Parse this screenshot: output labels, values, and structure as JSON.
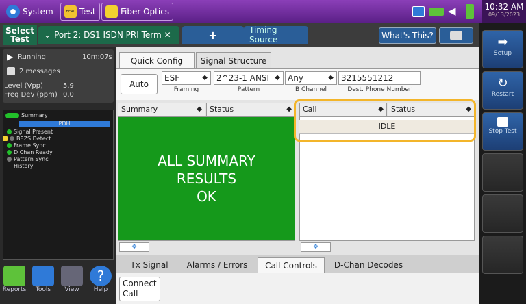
{
  "topbar": {
    "system_label": "System",
    "test_label": "Test",
    "bert_badge": "BERT",
    "fiber_label": "Fiber Optics",
    "clock_time": "10:32 AM",
    "clock_date": "09/13/2023"
  },
  "tabs": {
    "select_test": "Select Test",
    "port_tab": "Port 2: DS1 ISDN PRI Term",
    "plus_tab": "+",
    "timing_tab": "Timing Source",
    "whats_this": "What's This?"
  },
  "status": {
    "running_label": "Running",
    "running_time": "10m:07s",
    "messages": "2 messages",
    "level_label": "Level (Vpp)",
    "level_value": "5.9",
    "freq_label": "Freq Dev (ppm)",
    "freq_value": "0.0"
  },
  "tree": {
    "summary": "Summary",
    "pdh": "PDH",
    "signal_present": "Signal Present",
    "b8zs_detect": "B8ZS Detect",
    "frame_sync": "Frame Sync",
    "d_chan_ready": "D Chan Ready",
    "pattern_sync": "Pattern Sync",
    "history": "History"
  },
  "bottom_nav": {
    "reports": "Reports",
    "tools": "Tools",
    "view": "View",
    "help": "Help"
  },
  "right_buttons": {
    "setup": "Setup",
    "restart": "Restart",
    "stop_test": "Stop Test"
  },
  "subtabs": {
    "quick_config": "Quick Config",
    "signal_structure": "Signal Structure"
  },
  "config": {
    "auto_label": "Auto",
    "framing_value": "ESF",
    "framing_label": "Framing",
    "pattern_value": "2^23-1 ANSI",
    "pattern_label": "Pattern",
    "channel_value": "Any",
    "channel_label": "B Channel",
    "phone_value": "3215551212",
    "phone_label": "Dest. Phone Number"
  },
  "summary_pane": {
    "col1": "Summary",
    "col2": "Status",
    "line1": "ALL SUMMARY",
    "line2": "RESULTS",
    "line3": "OK"
  },
  "call_pane": {
    "col1": "Call",
    "col2": "Status",
    "status_value": "IDLE"
  },
  "bottom_tabs": {
    "tx_signal": "Tx Signal",
    "alarms_errors": "Alarms / Errors",
    "call_controls": "Call Controls",
    "d_chan_decodes": "D-Chan Decodes"
  },
  "actions": {
    "connect_call": "Connect Call"
  },
  "colors": {
    "summary_ok": "#15991b",
    "highlight": "#f3b52a",
    "topbar": "#6b2c98"
  }
}
